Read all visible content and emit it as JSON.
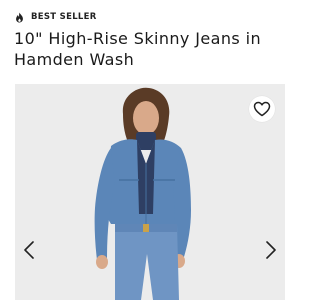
{
  "badge": {
    "label": "BEST SELLER",
    "icon": "flame-icon"
  },
  "product": {
    "title": "10\" High-Rise Skinny Jeans in Hamden Wash"
  },
  "gallery": {
    "favorite_icon": "heart-icon",
    "prev_icon": "chevron-left-icon",
    "next_icon": "chevron-right-icon"
  },
  "colors": {
    "text": "#1a1a1a",
    "image_bg": "#ececec",
    "denim_jacket": "#5b86b8",
    "turtleneck": "#2e3f63",
    "jeans": "#6f95c4"
  }
}
